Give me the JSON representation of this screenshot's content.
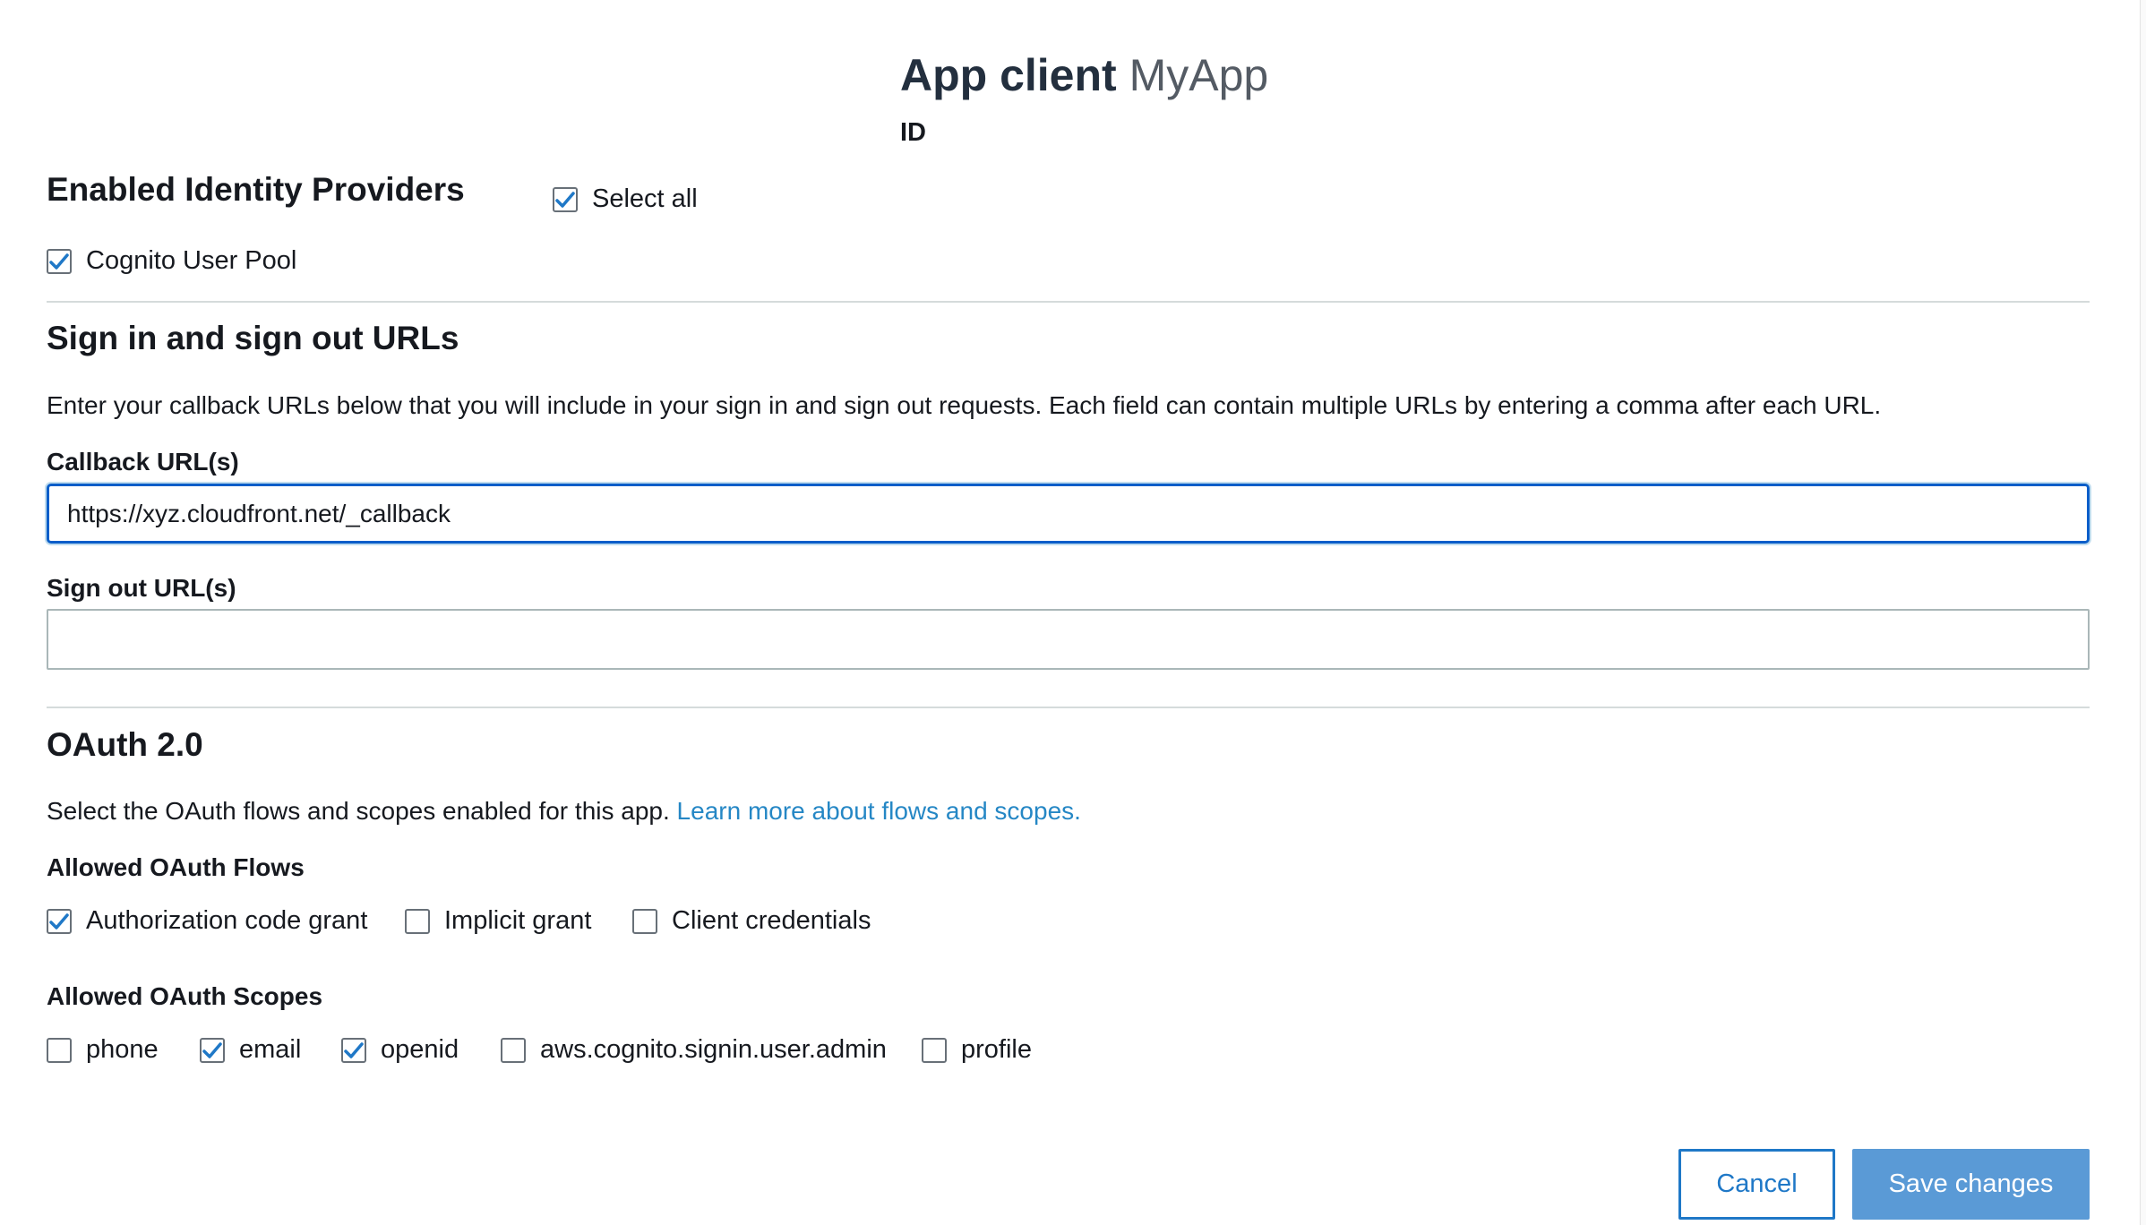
{
  "header": {
    "title_prefix": "App client",
    "title_app_name": "MyApp",
    "id_label": "ID"
  },
  "identity_providers": {
    "heading": "Enabled Identity Providers",
    "select_all_label": "Select all",
    "select_all_checked": true,
    "providers": [
      {
        "label": "Cognito User Pool",
        "checked": true
      }
    ]
  },
  "urls": {
    "heading": "Sign in and sign out URLs",
    "description": "Enter your callback URLs below that you will include in your sign in and sign out requests. Each field can contain multiple URLs by entering a comma after each URL.",
    "callback_label": "Callback URL(s)",
    "callback_value": "https://xyz.cloudfront.net/_callback",
    "signout_label": "Sign out URL(s)",
    "signout_value": ""
  },
  "oauth": {
    "heading": "OAuth 2.0",
    "description": "Select the OAuth flows and scopes enabled for this app.",
    "learn_more_link": "Learn more about flows and scopes.",
    "flows_heading": "Allowed OAuth Flows",
    "flows": [
      {
        "label": "Authorization code grant",
        "checked": true
      },
      {
        "label": "Implicit grant",
        "checked": false
      },
      {
        "label": "Client credentials",
        "checked": false
      }
    ],
    "scopes_heading": "Allowed OAuth Scopes",
    "scopes": [
      {
        "label": "phone",
        "checked": false
      },
      {
        "label": "email",
        "checked": true
      },
      {
        "label": "openid",
        "checked": true
      },
      {
        "label": "aws.cognito.signin.user.admin",
        "checked": false
      },
      {
        "label": "profile",
        "checked": false
      }
    ]
  },
  "actions": {
    "cancel_label": "Cancel",
    "save_label": "Save changes"
  },
  "colors": {
    "link": "#0073bb",
    "focus_border": "#0a5ec9",
    "primary_button": "#5a9ad6",
    "check_mark": "#1f78c7"
  }
}
